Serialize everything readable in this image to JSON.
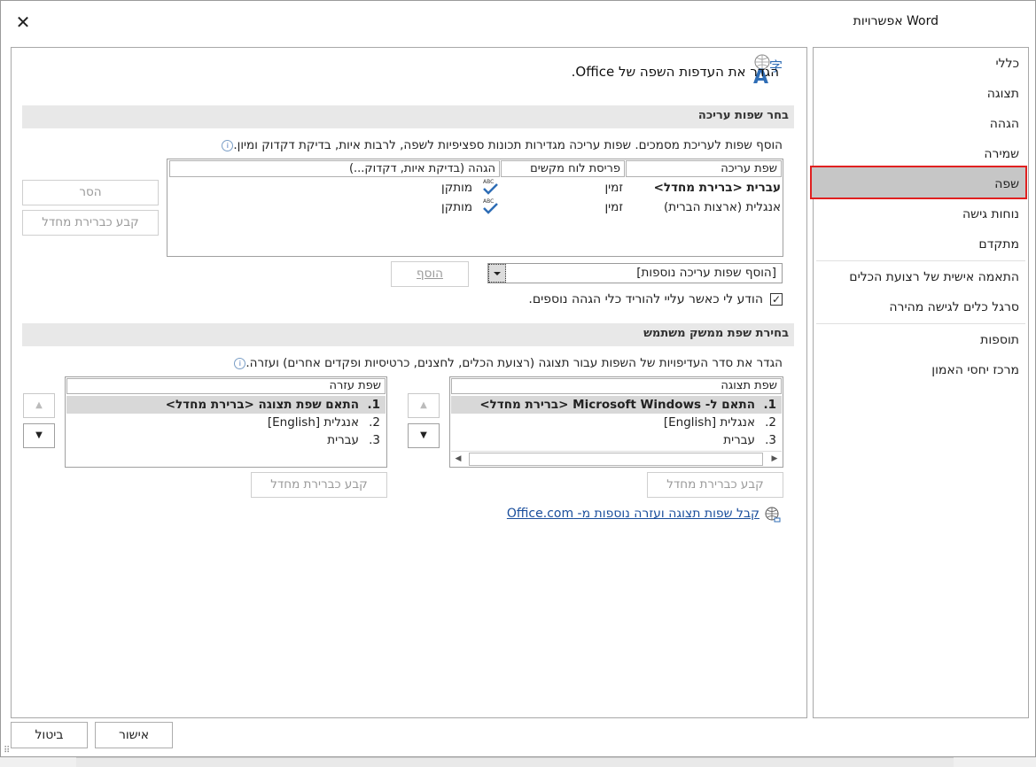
{
  "window": {
    "title": "אפשרויות Word",
    "close_glyph": "✕"
  },
  "nav": {
    "items": [
      {
        "label": "כללי"
      },
      {
        "label": "תצוגה"
      },
      {
        "label": "הגהה"
      },
      {
        "label": "שמירה"
      },
      {
        "label": "שפה",
        "selected": true
      },
      {
        "label": "נוחות גישה"
      },
      {
        "label": "מתקדם"
      },
      {
        "label": "התאמה אישית של רצועת הכלים"
      },
      {
        "label": "סרגל כלים לגישה מהירה"
      },
      {
        "label": "תוספות"
      },
      {
        "label": "מרכז יחסי האמון"
      }
    ]
  },
  "main": {
    "heading": "הגדר את העדפות השפה של Office.",
    "editing": {
      "section_title": "בחר שפות עריכה",
      "description": "הוסף שפות לעריכת מסמכים. שפות עריכה מגדירות תכונות ספציפיות לשפה, לרבות איות, בדיקת דקדוק ומיון.",
      "info_glyph": "i",
      "columns": [
        "שפת עריכה",
        "פריסת לוח מקשים",
        "הגהה (בדיקת איות, דקדוק...)"
      ],
      "rows": [
        {
          "language": "עברית <ברירת מחדל>",
          "keyboard": "זמין",
          "proofing_icon": "abc-check-icon",
          "proofing": "מותקן"
        },
        {
          "language": "אנגלית (ארצות הברית)",
          "keyboard": "זמין",
          "proofing_icon": "abc-check-icon",
          "proofing": "מותקן"
        }
      ],
      "abc_text": "ABC",
      "remove_button": "הסר",
      "set_default_button": "קבע כברירת מחדל",
      "add_dropdown_value": "[הוסף שפות עריכה נוספות]",
      "add_button": "הוסף",
      "notify_checkbox_label": "הודע לי כאשר עליי להוריד כלי הגהה נוספים.",
      "notify_checked": true,
      "check_glyph": "✓"
    },
    "ui_language": {
      "section_title": "בחירת שפת ממשק משתמש",
      "description": "הגדר את סדר העדיפויות של השפות עבור תצוגה (רצועת הכלים, לחצנים, כרטיסיות ופקדים אחרים) ועזרה.",
      "display": {
        "header": "שפת תצוגה",
        "rows": [
          {
            "num": "1.",
            "label": "התאם ל- Microsoft Windows <ברירת מחדל>",
            "selected": true
          },
          {
            "num": "2.",
            "label": "אנגלית [English]"
          },
          {
            "num": "3.",
            "label": "עברית"
          }
        ],
        "set_default_button": "קבע כברירת מחדל"
      },
      "help": {
        "header": "שפת עזרה",
        "rows": [
          {
            "num": "1.",
            "label": "התאם שפת תצוגה <ברירת מחדל>",
            "selected": true
          },
          {
            "num": "2.",
            "label": "אנגלית [English]"
          },
          {
            "num": "3.",
            "label": "עברית"
          }
        ],
        "set_default_button": "קבע כברירת מחדל"
      },
      "up_glyph": "▲",
      "down_glyph": "▼",
      "scroll_left_glyph": "◀",
      "scroll_right_glyph": "▶",
      "office_link": "קבל שפות תצוגה ועזרה נוספות מ- Office.com"
    }
  },
  "footer": {
    "ok_button": "אישור",
    "cancel_button": "ביטול"
  },
  "colors": {
    "selection_outline": "#e02020",
    "selected_bg": "#c6c6c6",
    "link": "#1a4e9c"
  }
}
